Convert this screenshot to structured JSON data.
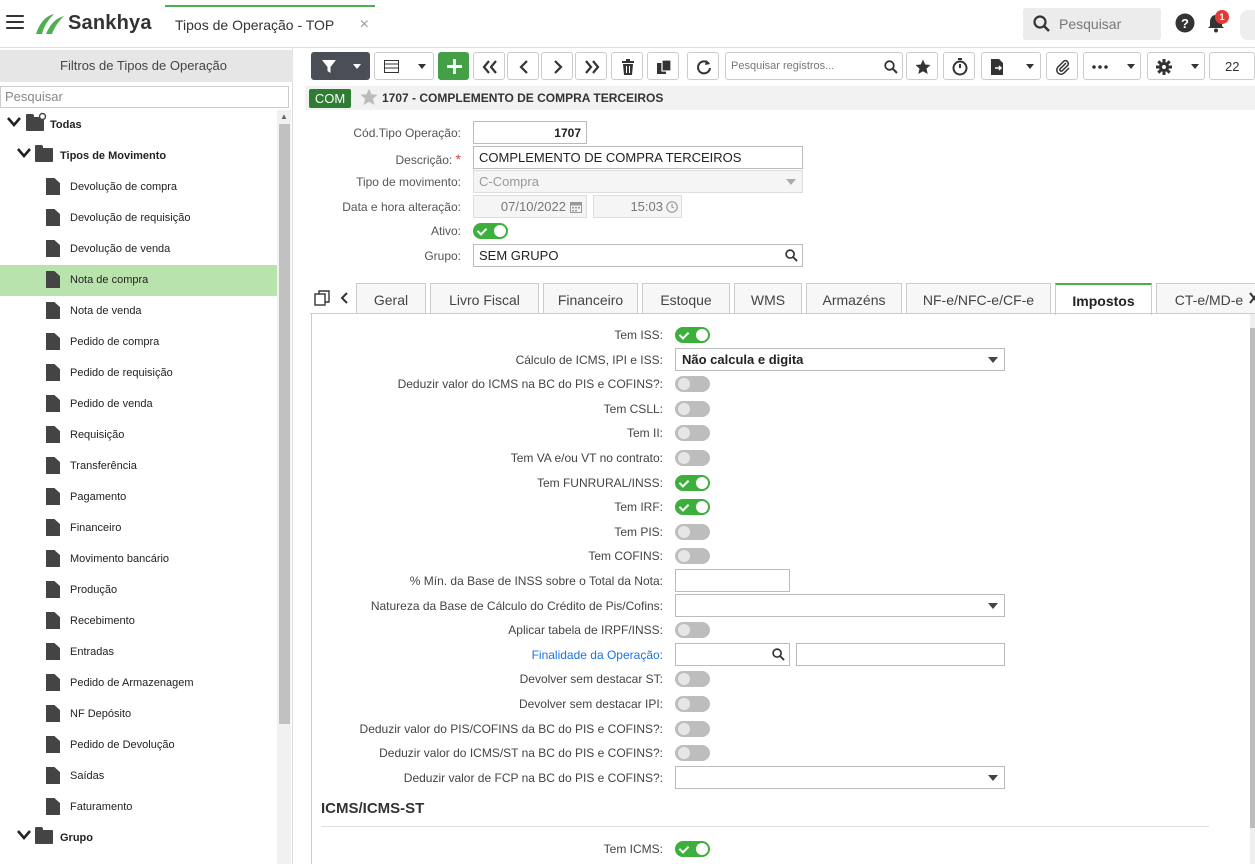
{
  "topbar": {
    "app_name": "Sankhya",
    "tab_title": "Tipos de Operação - TOP",
    "tab_close": "×",
    "search_placeholder": "Pesquisar",
    "notification_count": "1"
  },
  "left_panel": {
    "title": "Filtros de Tipos de Operação",
    "search_placeholder": "Pesquisar",
    "tree": [
      {
        "label": "Todas",
        "type": "root"
      },
      {
        "label": "Tipos de Movimento",
        "type": "folder"
      },
      {
        "label": "Devolução de compra",
        "type": "doc"
      },
      {
        "label": "Devolução de requisição",
        "type": "doc"
      },
      {
        "label": "Devolução de venda",
        "type": "doc"
      },
      {
        "label": "Nota de compra",
        "type": "doc",
        "selected": true
      },
      {
        "label": "Nota de venda",
        "type": "doc"
      },
      {
        "label": "Pedido de compra",
        "type": "doc"
      },
      {
        "label": "Pedido de requisição",
        "type": "doc"
      },
      {
        "label": "Pedido de venda",
        "type": "doc"
      },
      {
        "label": "Requisição",
        "type": "doc"
      },
      {
        "label": "Transferência",
        "type": "doc"
      },
      {
        "label": "Pagamento",
        "type": "doc"
      },
      {
        "label": "Financeiro",
        "type": "doc"
      },
      {
        "label": "Movimento bancário",
        "type": "doc"
      },
      {
        "label": "Produção",
        "type": "doc"
      },
      {
        "label": "Recebimento",
        "type": "doc"
      },
      {
        "label": "Entradas",
        "type": "doc"
      },
      {
        "label": "Pedido de Armazenagem",
        "type": "doc"
      },
      {
        "label": "NF Depósito",
        "type": "doc"
      },
      {
        "label": "Pedido de Devolução",
        "type": "doc"
      },
      {
        "label": "Saídas",
        "type": "doc"
      },
      {
        "label": "Faturamento",
        "type": "doc"
      },
      {
        "label": "Grupo",
        "type": "folder"
      }
    ]
  },
  "toolbar": {
    "search_placeholder": "Pesquisar registros...",
    "page_size": "22"
  },
  "record": {
    "badge": "COM",
    "title": "1707 - COMPLEMENTO DE COMPRA TERCEIROS"
  },
  "form": {
    "cod_label": "Cód.Tipo Operação:",
    "cod_value": "1707",
    "descricao_label": "Descrição:",
    "descricao_required": "*",
    "descricao_value": "COMPLEMENTO DE COMPRA TERCEIROS",
    "tipo_mov_label": "Tipo de movimento:",
    "tipo_mov_value": "C-Compra",
    "data_label": "Data e hora alteração:",
    "data_value": "07/10/2022",
    "hora_value": "15:03",
    "ativo_label": "Ativo:",
    "ativo_on": true,
    "grupo_label": "Grupo:",
    "grupo_value": "SEM GRUPO"
  },
  "tabs": [
    "Geral",
    "Livro Fiscal",
    "Financeiro",
    "Estoque",
    "WMS",
    "Armazéns",
    "NF-e/NFC-e/CF-e",
    "Impostos",
    "CT-e/MD-e"
  ],
  "active_tab": "Impostos",
  "impostos": {
    "fields": [
      {
        "label": "Tem ISS:",
        "kind": "toggle",
        "on": true
      },
      {
        "label": "Cálculo de ICMS, IPI e ISS:",
        "kind": "select",
        "value": "Não calcula e digita"
      },
      {
        "label": "Deduzir valor do ICMS na BC do PIS e COFINS?:",
        "kind": "toggle",
        "on": false
      },
      {
        "label": "Tem CSLL:",
        "kind": "toggle",
        "on": false
      },
      {
        "label": "Tem II:",
        "kind": "toggle",
        "on": false
      },
      {
        "label": "Tem VA e/ou VT no contrato:",
        "kind": "toggle",
        "on": false
      },
      {
        "label": "Tem FUNRURAL/INSS:",
        "kind": "toggle",
        "on": true
      },
      {
        "label": "Tem IRF:",
        "kind": "toggle",
        "on": true
      },
      {
        "label": "Tem PIS:",
        "kind": "toggle",
        "on": false
      },
      {
        "label": "Tem COFINS:",
        "kind": "toggle",
        "on": false
      },
      {
        "label": "% Mín. da Base de INSS sobre o Total da Nota:",
        "kind": "text",
        "value": ""
      },
      {
        "label": "Natureza da Base de Cálculo do Crédito de Pis/Cofins:",
        "kind": "select",
        "value": ""
      },
      {
        "label": "Aplicar tabela de IRPF/INSS:",
        "kind": "toggle",
        "on": false
      },
      {
        "label": "Finalidade da Operação:",
        "kind": "lookup",
        "value": "",
        "link": true
      },
      {
        "label": "Devolver sem destacar ST:",
        "kind": "toggle",
        "on": false
      },
      {
        "label": "Devolver sem destacar IPI:",
        "kind": "toggle",
        "on": false
      },
      {
        "label": "Deduzir valor do PIS/COFINS da BC do PIS e COFINS?:",
        "kind": "toggle",
        "on": false
      },
      {
        "label": "Deduzir valor do ICMS/ST na BC do PIS e COFINS?:",
        "kind": "toggle",
        "on": false
      },
      {
        "label": "Deduzir valor de FCP na BC do PIS e COFINS?:",
        "kind": "select",
        "value": ""
      }
    ],
    "section_title": "ICMS/ICMS-ST",
    "tem_icms_label": "Tem ICMS:",
    "tem_icms_on": true
  }
}
